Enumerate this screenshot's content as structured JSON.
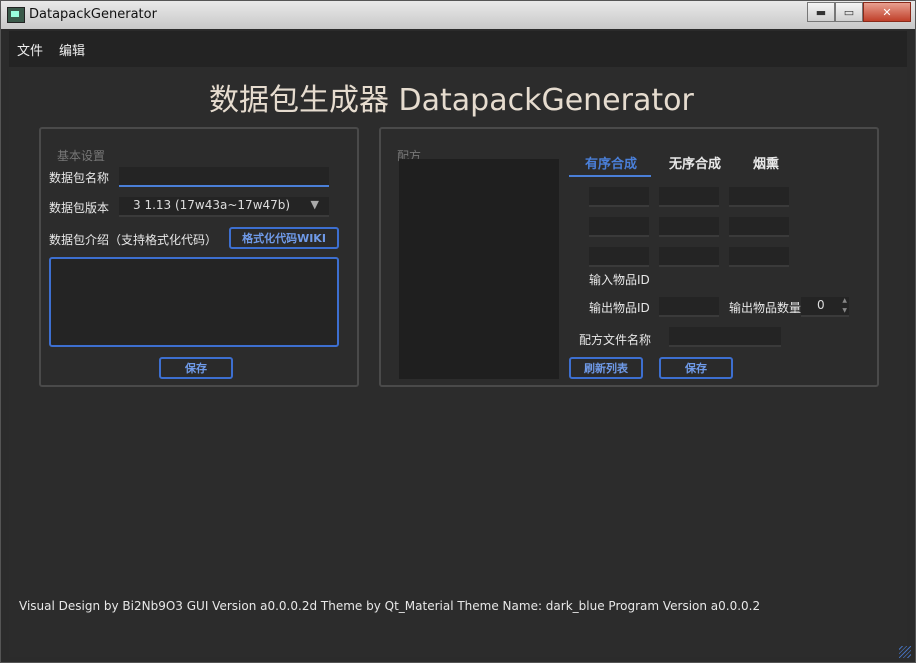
{
  "window": {
    "title": "DatapackGenerator",
    "minimize": "▬",
    "maximize": "▭",
    "close": "✕"
  },
  "menu": [
    "文件",
    "编辑"
  ],
  "app_title": "数据包生成器 DatapackGenerator",
  "basic": {
    "group_title": "基本设置",
    "name_label": "数据包名称",
    "name_value": "",
    "version_label": "数据包版本",
    "version_value": "3   1.13 (17w43a~17w47b)",
    "desc_label": "数据包介绍（支持格式化代码）",
    "format_wiki_button": "格式化代码WIKI",
    "desc_value": "",
    "save_button": "保存"
  },
  "recipe": {
    "group_title": "配方",
    "tabs": [
      "有序合成",
      "无序合成",
      "烟熏"
    ],
    "active_tab": 0,
    "input_label": "输入物品ID",
    "output_label": "输出物品ID",
    "output_count_label": "输出物品数量",
    "output_count_value": "0",
    "file_name_label": "配方文件名称",
    "refresh_button": "刷新列表",
    "save_button": "保存"
  },
  "footer": "Visual Design by Bi2Nb9O3    GUI Version a0.0.0.2d Theme by Qt_Material Theme Name: dark_blue Program Version a0.0.0.2",
  "colors": {
    "accent": "#4a7fd8",
    "background": "#2c2c2c",
    "title": "#e6dccf"
  }
}
